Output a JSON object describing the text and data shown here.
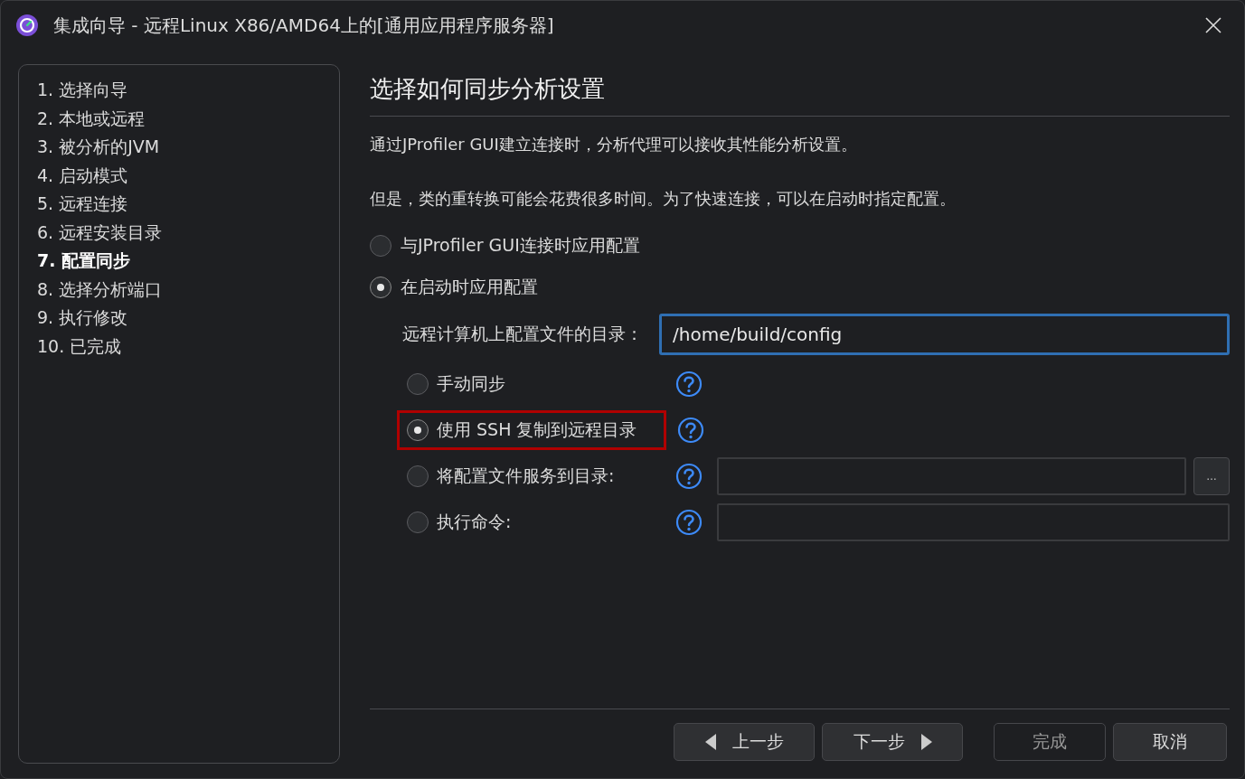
{
  "window": {
    "title": "集成向导 - 远程Linux X86/AMD64上的[通用应用程序服务器]"
  },
  "steps": [
    {
      "label": "1. 选择向导",
      "selected": false
    },
    {
      "label": "2. 本地或远程",
      "selected": false
    },
    {
      "label": "3. 被分析的JVM",
      "selected": false
    },
    {
      "label": "4. 启动模式",
      "selected": false
    },
    {
      "label": "5. 远程连接",
      "selected": false
    },
    {
      "label": "6. 远程安装目录",
      "selected": false
    },
    {
      "label": "7. 配置同步",
      "selected": true
    },
    {
      "label": "8. 选择分析端口",
      "selected": false
    },
    {
      "label": "9. 执行修改",
      "selected": false
    },
    {
      "label": "10. 已完成",
      "selected": false
    }
  ],
  "heading": "选择如何同步分析设置",
  "paragraphs": [
    "通过JProfiler GUI建立连接时，分析代理可以接收其性能分析设置。",
    "但是，类的重转换可能会花费很多时间。为了快速连接，可以在启动时指定配置。"
  ],
  "apply_options": [
    {
      "label": "与JProfiler GUI连接时应用配置",
      "selected": false
    },
    {
      "label": "在启动时应用配置",
      "selected": true
    }
  ],
  "config_dir": {
    "label": "远程计算机上配置文件的目录：",
    "value": "/home/build/config",
    "focused": true
  },
  "sync_options": [
    {
      "kind": "plain",
      "label": "手动同步",
      "selected": false,
      "highlighted": false
    },
    {
      "kind": "plain",
      "label": "使用 SSH 复制到远程目录",
      "selected": true,
      "highlighted": true
    },
    {
      "kind": "browse",
      "label": "将配置文件服务到目录:",
      "selected": false,
      "highlighted": false,
      "browse_label": "…"
    },
    {
      "kind": "field",
      "label": "执行命令:",
      "selected": false,
      "highlighted": false
    }
  ],
  "buttons": [
    {
      "kind": "back",
      "label": "上一步",
      "disabled": false
    },
    {
      "kind": "next",
      "label": "下一步",
      "disabled": false
    },
    {
      "kind": "plain",
      "label": "完成",
      "disabled": true
    },
    {
      "kind": "plain",
      "label": "取消",
      "disabled": false
    }
  ]
}
